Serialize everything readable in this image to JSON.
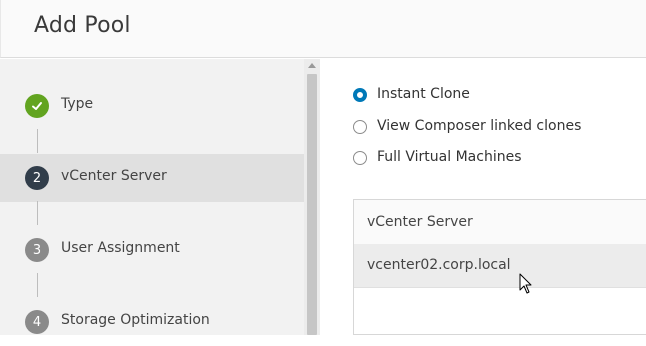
{
  "dialog": {
    "title": "Add Pool"
  },
  "steps": [
    {
      "number": "✓",
      "label": "Type",
      "state": "done"
    },
    {
      "number": "2",
      "label": "vCenter Server",
      "state": "current"
    },
    {
      "number": "3",
      "label": "User Assignment",
      "state": "pending"
    },
    {
      "number": "4",
      "label": "Storage Optimization",
      "state": "pending"
    }
  ],
  "clone_options": [
    {
      "label": "Instant Clone",
      "selected": true
    },
    {
      "label": "View Composer linked clones",
      "selected": false
    },
    {
      "label": "Full Virtual Machines",
      "selected": false
    }
  ],
  "vcenter_grid": {
    "column_header": "vCenter Server",
    "rows": [
      "vcenter02.corp.local"
    ]
  },
  "colors": {
    "accent": "#0079b8",
    "step_done": "#62a420",
    "step_current": "#313d4a",
    "step_pending": "#8a8a8a"
  }
}
